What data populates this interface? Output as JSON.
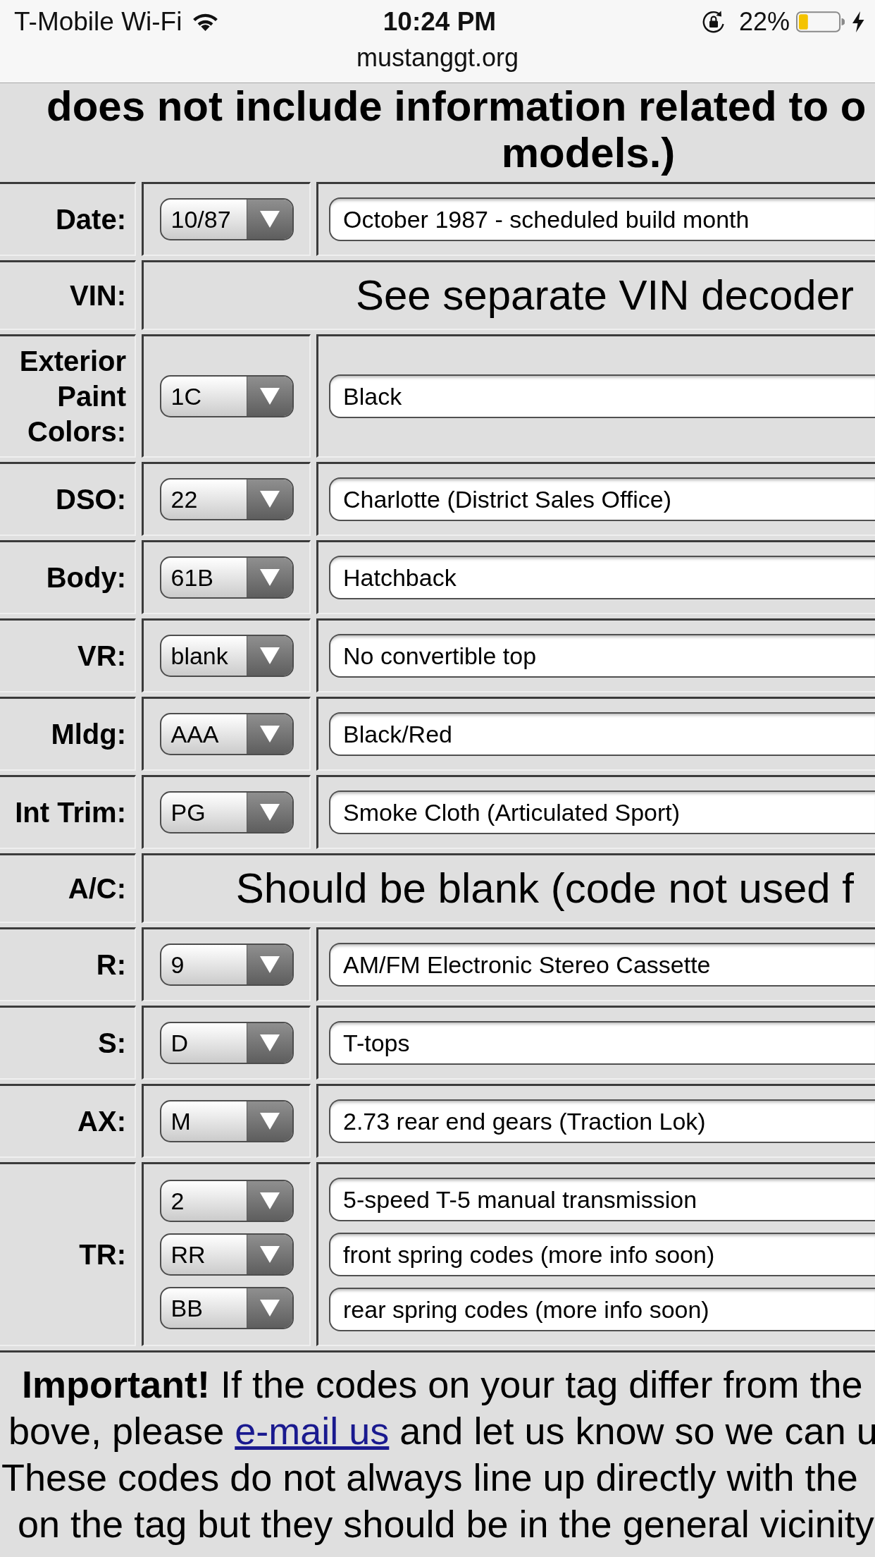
{
  "status_bar": {
    "carrier": "T-Mobile Wi-Fi",
    "time": "10:24 PM",
    "battery": "22%"
  },
  "address_bar": {
    "url": "mustanggt.org"
  },
  "intro": {
    "lines": [
      "does not include information related to o",
      "models.)"
    ]
  },
  "table": {
    "rows": [
      {
        "label": "Date:",
        "kind": "codes",
        "entries": [
          {
            "code": "10/87",
            "description": "October 1987 - scheduled build month"
          }
        ]
      },
      {
        "label": "VIN:",
        "kind": "note",
        "note": "See separate VIN decoder"
      },
      {
        "label": "Exterior Paint Colors:",
        "kind": "codes",
        "entries": [
          {
            "code": "1C",
            "description": "Black"
          }
        ]
      },
      {
        "label": "DSO:",
        "kind": "codes",
        "entries": [
          {
            "code": "22",
            "description": "Charlotte (District Sales Office)"
          }
        ]
      },
      {
        "label": "Body:",
        "kind": "codes",
        "entries": [
          {
            "code": "61B",
            "description": "Hatchback"
          }
        ]
      },
      {
        "label": "VR:",
        "kind": "codes",
        "entries": [
          {
            "code": "blank",
            "description": "No convertible top"
          }
        ]
      },
      {
        "label": "Mldg:",
        "kind": "codes",
        "entries": [
          {
            "code": "AAA",
            "description": "Black/Red"
          }
        ]
      },
      {
        "label": "Int Trim:",
        "kind": "codes",
        "entries": [
          {
            "code": "PG",
            "description": "Smoke Cloth (Articulated Sport)"
          }
        ]
      },
      {
        "label": "A/C:",
        "kind": "note",
        "note": "Should be blank (code not used f"
      },
      {
        "label": "R:",
        "kind": "codes",
        "entries": [
          {
            "code": "9",
            "description": "AM/FM Electronic Stereo Cassette"
          }
        ]
      },
      {
        "label": "S:",
        "kind": "codes",
        "entries": [
          {
            "code": "D",
            "description": "T-tops"
          }
        ]
      },
      {
        "label": "AX:",
        "kind": "codes",
        "entries": [
          {
            "code": "M",
            "description": "2.73 rear end gears (Traction Lok)"
          }
        ]
      },
      {
        "label": "TR:",
        "kind": "codes",
        "entries": [
          {
            "code": "2",
            "description": "5-speed T-5 manual transmission"
          },
          {
            "code": "RR",
            "description": "front spring codes (more info soon)"
          },
          {
            "code": "BB",
            "description": "rear spring codes (more info soon)"
          }
        ]
      }
    ]
  },
  "notice": {
    "lines": [
      {
        "kind": "text",
        "text": "**Important!** If the codes on your tag differ from the"
      },
      {
        "kind": "link",
        "before": "bove, please",
        "link": "e-mail us",
        "after": "and let us know so we can u"
      },
      {
        "kind": "text",
        "text": "These codes do not always line up directly with the"
      },
      {
        "kind": "text",
        "text": "on the tag but they should be in the general vicinity"
      }
    ]
  }
}
